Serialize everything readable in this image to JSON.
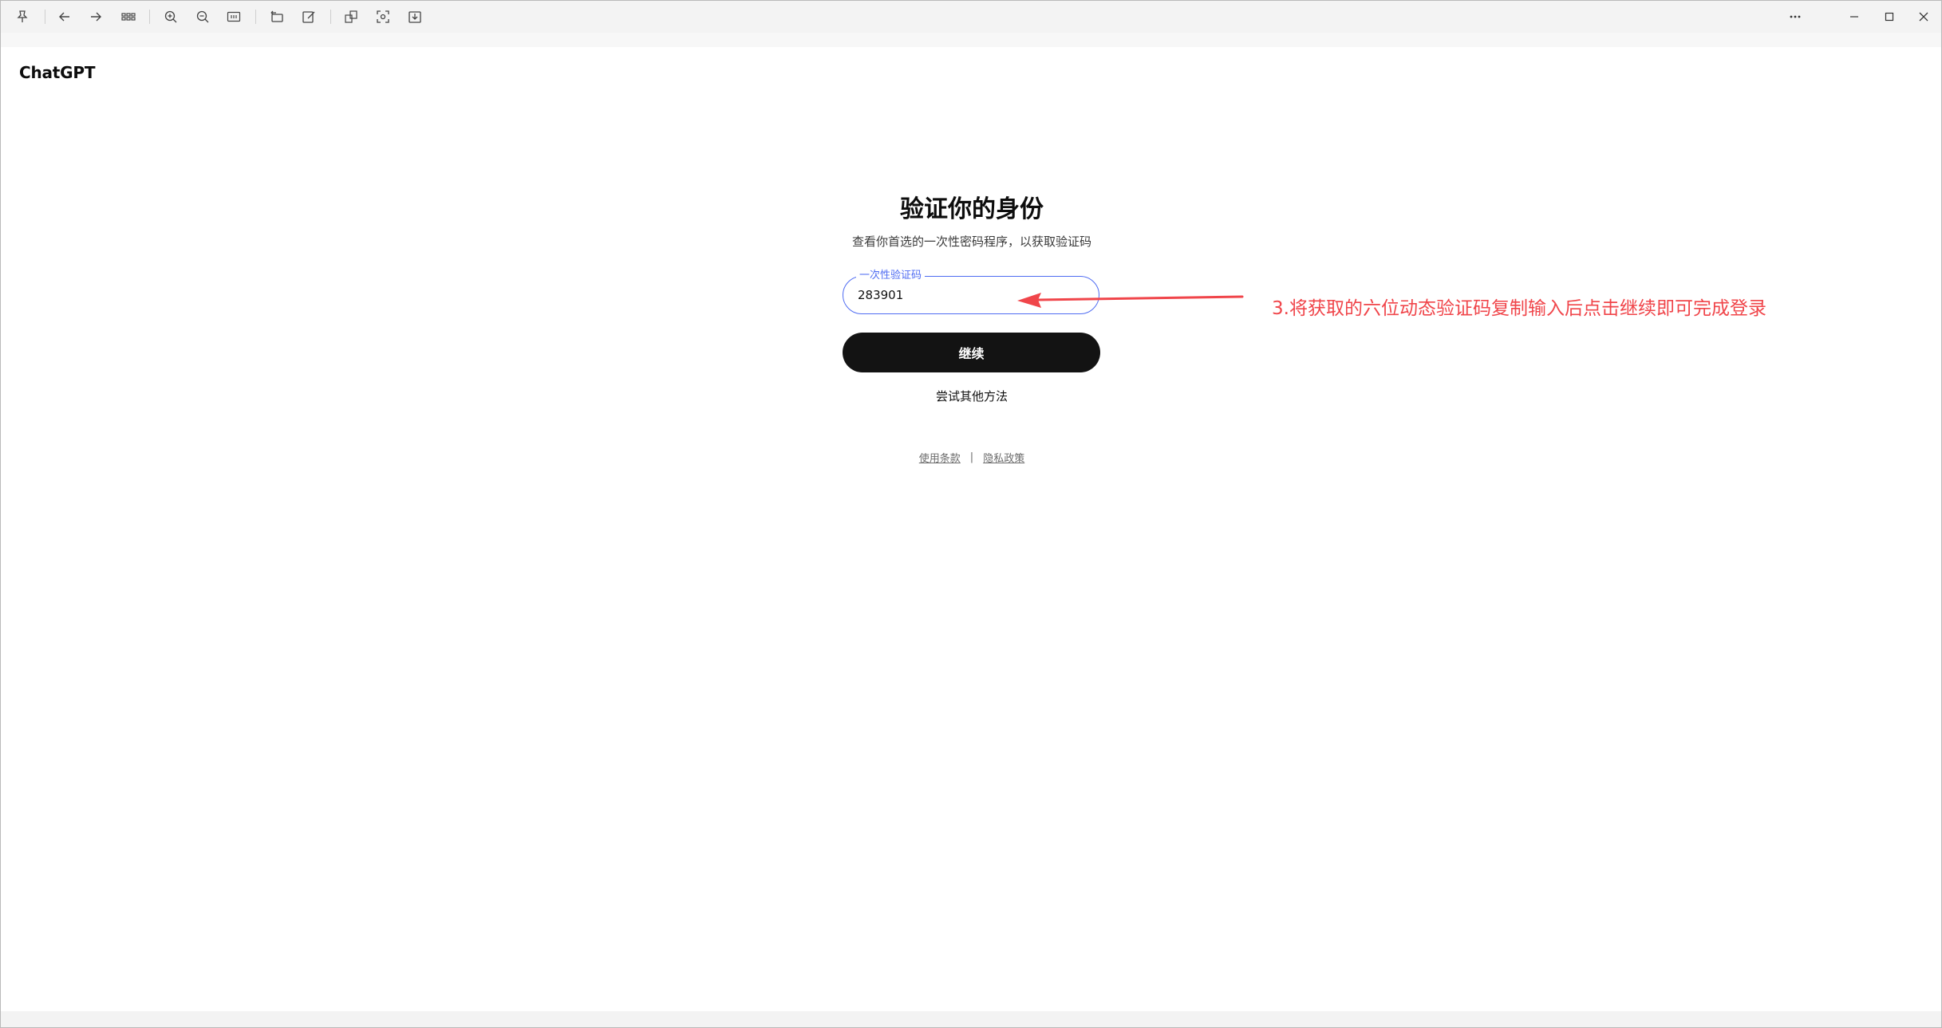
{
  "toolbar": {
    "buttons": [
      {
        "name": "pin-icon"
      },
      {
        "name": "back-arrow-icon"
      },
      {
        "name": "forward-arrow-icon"
      },
      {
        "name": "grid-view-icon"
      },
      {
        "name": "zoom-in-icon"
      },
      {
        "name": "zoom-out-icon"
      },
      {
        "name": "fit-width-icon"
      },
      {
        "name": "rotate-icon"
      },
      {
        "name": "edit-icon"
      },
      {
        "name": "copy-icon"
      },
      {
        "name": "screenshot-icon"
      },
      {
        "name": "save-icon"
      }
    ],
    "window_controls": [
      {
        "name": "more-icon"
      },
      {
        "name": "minimize-icon"
      },
      {
        "name": "maximize-icon"
      },
      {
        "name": "close-icon"
      }
    ]
  },
  "header": {
    "brand": "ChatGPT"
  },
  "main": {
    "title": "验证你的身份",
    "subtitle": "查看你首选的一次性密码程序，以获取验证码",
    "code_field": {
      "label": "一次性验证码",
      "value": "283901"
    },
    "continue_label": "继续",
    "alt_method_label": "尝试其他方法"
  },
  "footer": {
    "terms_label": "使用条款",
    "separator": "|",
    "privacy_label": "隐私政策"
  },
  "annotation": {
    "text": "3.将获取的六位动态验证码复制输入后点击继续即可完成登录",
    "color": "#f0454a"
  },
  "colors": {
    "accent": "#4f6cf2",
    "button_bg": "#131313",
    "annotation": "#f0454a"
  }
}
